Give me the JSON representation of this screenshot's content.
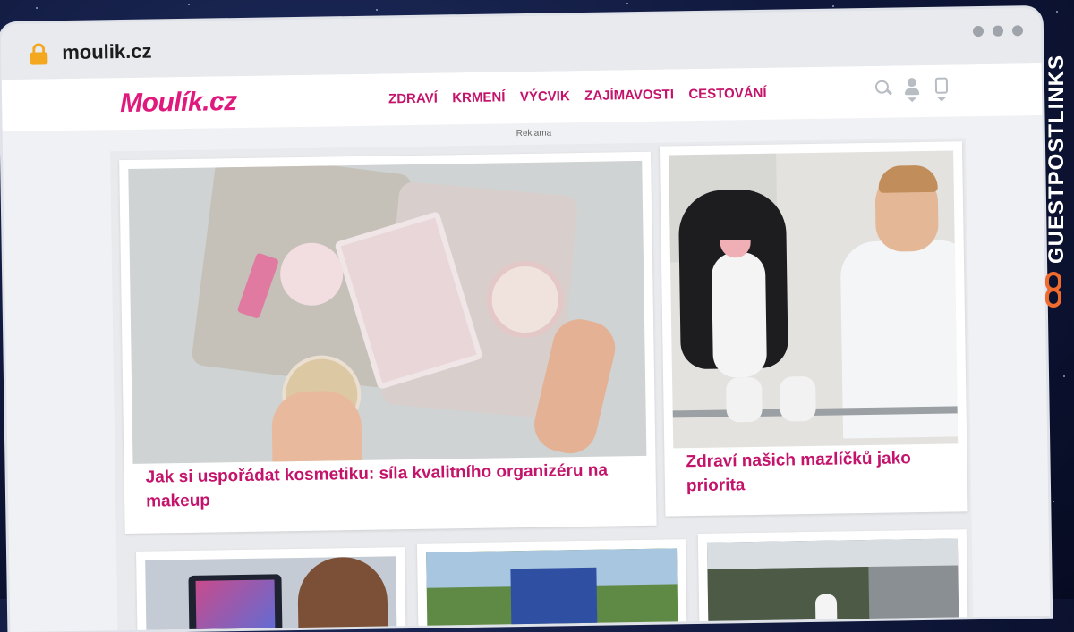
{
  "browser": {
    "url": "moulik.cz"
  },
  "header": {
    "logo": "Moulík.cz",
    "nav": [
      "ZDRAVÍ",
      "KRMENÍ",
      "VÝCVIK",
      "ZAJÍMAVOSTI",
      "CESTOVÁNÍ"
    ],
    "ad_label": "Reklama"
  },
  "articles": [
    {
      "title": "Jak si uspořádat kosmetiku: síla kvalitního organizéru na makeup"
    },
    {
      "title": "Zdraví našich mazlíčků jako priorita"
    }
  ],
  "side_brand": {
    "text": "GUESTPOSTLINKS",
    "accent": "#ef6b2e"
  },
  "colors": {
    "brand": "#e0197d",
    "nav_text": "#c4136b"
  }
}
